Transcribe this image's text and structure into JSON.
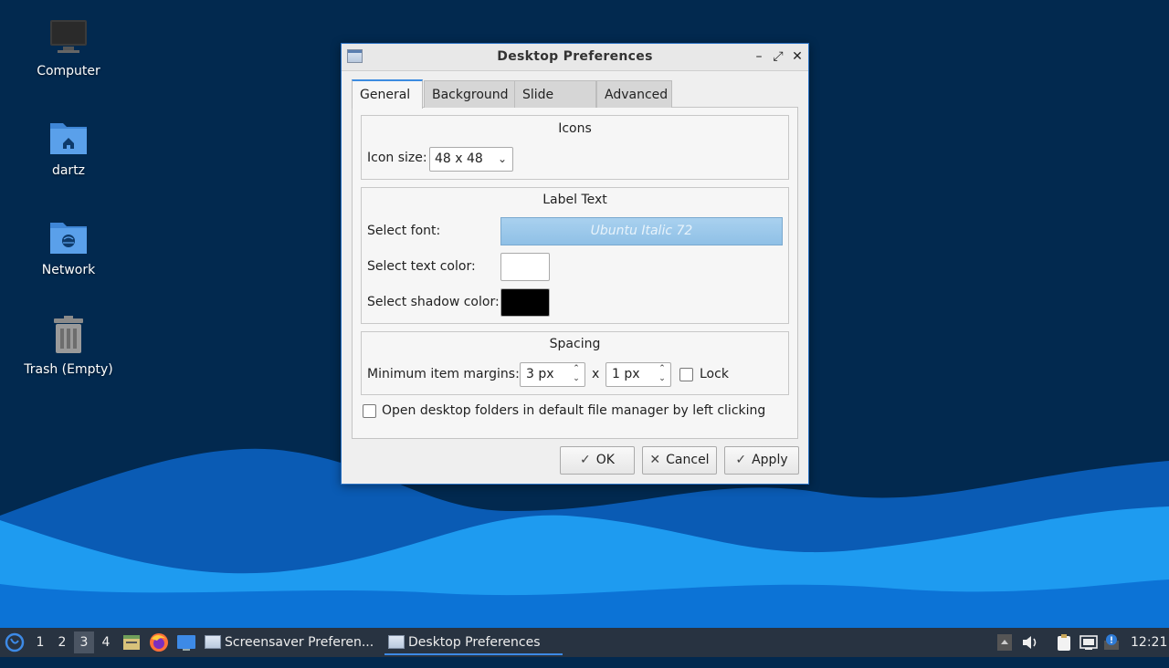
{
  "desktop": {
    "icons": [
      {
        "label": "Computer",
        "icon": "computer-icon"
      },
      {
        "label": "dartz",
        "icon": "home-folder-icon"
      },
      {
        "label": "Network",
        "icon": "network-folder-icon"
      },
      {
        "label": "Trash (Empty)",
        "icon": "trash-icon"
      }
    ]
  },
  "dialog": {
    "title": "Desktop Preferences",
    "controls": {
      "minimize": "–",
      "maximize": "⤢",
      "close": "✕"
    },
    "tabs": [
      {
        "label": "General",
        "active": true
      },
      {
        "label": "Background",
        "active": false
      },
      {
        "label": "Slide Show",
        "active": false
      },
      {
        "label": "Advanced",
        "active": false
      }
    ],
    "icons_group": {
      "title": "Icons",
      "icon_size_label": "Icon size:",
      "icon_size_value": "48 x 48"
    },
    "label_text_group": {
      "title": "Label Text",
      "font_label": "Select font:",
      "font_value": "Ubuntu Italic 72",
      "text_color_label": "Select text color:",
      "text_color": "#ffffff",
      "shadow_color_label": "Select shadow color:",
      "shadow_color": "#000000"
    },
    "spacing_group": {
      "title": "Spacing",
      "margins_label": "Minimum item margins:",
      "margin_x": "3 px",
      "separator": "x",
      "margin_y": "1 px",
      "lock_label": "Lock",
      "lock_checked": false
    },
    "open_folders_label": "Open desktop folders in default file manager by left clicking",
    "open_folders_checked": false,
    "buttons": {
      "ok": "OK",
      "cancel": "Cancel",
      "apply": "Apply"
    }
  },
  "taskbar": {
    "workspaces": [
      "1",
      "2",
      "3",
      "4"
    ],
    "active_workspace": "3",
    "tasks": [
      {
        "label": "Screensaver Preferen...",
        "active": false
      },
      {
        "label": "Desktop Preferences",
        "active": true
      }
    ],
    "clock": "12:21"
  },
  "colors": {
    "desktop_bg": "#02294f",
    "wave_light": "#1e9bf0",
    "wave_mid": "#0c73d6",
    "accent": "#3c8ce0",
    "taskbar_bg": "#283341"
  }
}
